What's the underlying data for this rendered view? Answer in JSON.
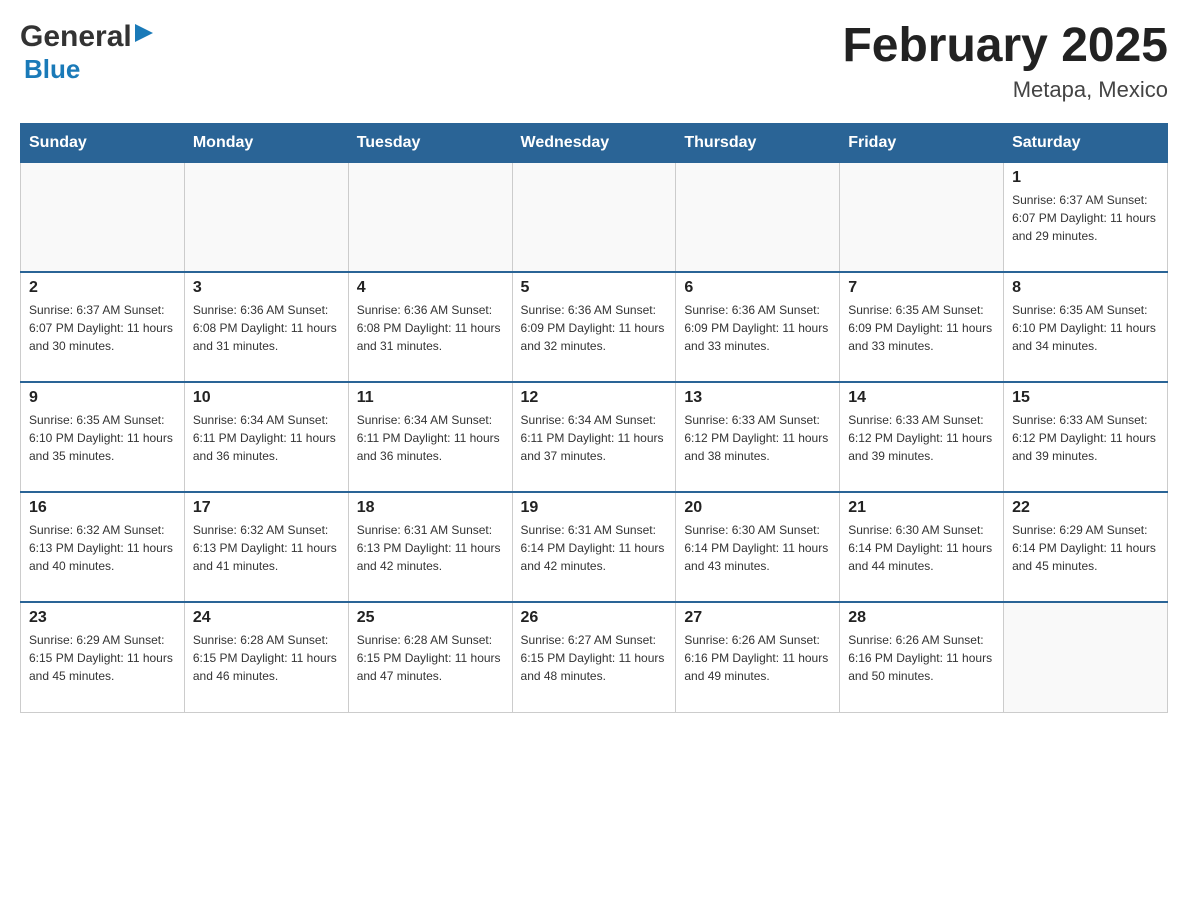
{
  "header": {
    "logo_general": "General",
    "logo_blue": "Blue",
    "month_title": "February 2025",
    "location": "Metapa, Mexico"
  },
  "weekdays": [
    "Sunday",
    "Monday",
    "Tuesday",
    "Wednesday",
    "Thursday",
    "Friday",
    "Saturday"
  ],
  "weeks": [
    {
      "days": [
        {
          "number": "",
          "info": ""
        },
        {
          "number": "",
          "info": ""
        },
        {
          "number": "",
          "info": ""
        },
        {
          "number": "",
          "info": ""
        },
        {
          "number": "",
          "info": ""
        },
        {
          "number": "",
          "info": ""
        },
        {
          "number": "1",
          "info": "Sunrise: 6:37 AM\nSunset: 6:07 PM\nDaylight: 11 hours\nand 29 minutes."
        }
      ]
    },
    {
      "days": [
        {
          "number": "2",
          "info": "Sunrise: 6:37 AM\nSunset: 6:07 PM\nDaylight: 11 hours\nand 30 minutes."
        },
        {
          "number": "3",
          "info": "Sunrise: 6:36 AM\nSunset: 6:08 PM\nDaylight: 11 hours\nand 31 minutes."
        },
        {
          "number": "4",
          "info": "Sunrise: 6:36 AM\nSunset: 6:08 PM\nDaylight: 11 hours\nand 31 minutes."
        },
        {
          "number": "5",
          "info": "Sunrise: 6:36 AM\nSunset: 6:09 PM\nDaylight: 11 hours\nand 32 minutes."
        },
        {
          "number": "6",
          "info": "Sunrise: 6:36 AM\nSunset: 6:09 PM\nDaylight: 11 hours\nand 33 minutes."
        },
        {
          "number": "7",
          "info": "Sunrise: 6:35 AM\nSunset: 6:09 PM\nDaylight: 11 hours\nand 33 minutes."
        },
        {
          "number": "8",
          "info": "Sunrise: 6:35 AM\nSunset: 6:10 PM\nDaylight: 11 hours\nand 34 minutes."
        }
      ]
    },
    {
      "days": [
        {
          "number": "9",
          "info": "Sunrise: 6:35 AM\nSunset: 6:10 PM\nDaylight: 11 hours\nand 35 minutes."
        },
        {
          "number": "10",
          "info": "Sunrise: 6:34 AM\nSunset: 6:11 PM\nDaylight: 11 hours\nand 36 minutes."
        },
        {
          "number": "11",
          "info": "Sunrise: 6:34 AM\nSunset: 6:11 PM\nDaylight: 11 hours\nand 36 minutes."
        },
        {
          "number": "12",
          "info": "Sunrise: 6:34 AM\nSunset: 6:11 PM\nDaylight: 11 hours\nand 37 minutes."
        },
        {
          "number": "13",
          "info": "Sunrise: 6:33 AM\nSunset: 6:12 PM\nDaylight: 11 hours\nand 38 minutes."
        },
        {
          "number": "14",
          "info": "Sunrise: 6:33 AM\nSunset: 6:12 PM\nDaylight: 11 hours\nand 39 minutes."
        },
        {
          "number": "15",
          "info": "Sunrise: 6:33 AM\nSunset: 6:12 PM\nDaylight: 11 hours\nand 39 minutes."
        }
      ]
    },
    {
      "days": [
        {
          "number": "16",
          "info": "Sunrise: 6:32 AM\nSunset: 6:13 PM\nDaylight: 11 hours\nand 40 minutes."
        },
        {
          "number": "17",
          "info": "Sunrise: 6:32 AM\nSunset: 6:13 PM\nDaylight: 11 hours\nand 41 minutes."
        },
        {
          "number": "18",
          "info": "Sunrise: 6:31 AM\nSunset: 6:13 PM\nDaylight: 11 hours\nand 42 minutes."
        },
        {
          "number": "19",
          "info": "Sunrise: 6:31 AM\nSunset: 6:14 PM\nDaylight: 11 hours\nand 42 minutes."
        },
        {
          "number": "20",
          "info": "Sunrise: 6:30 AM\nSunset: 6:14 PM\nDaylight: 11 hours\nand 43 minutes."
        },
        {
          "number": "21",
          "info": "Sunrise: 6:30 AM\nSunset: 6:14 PM\nDaylight: 11 hours\nand 44 minutes."
        },
        {
          "number": "22",
          "info": "Sunrise: 6:29 AM\nSunset: 6:14 PM\nDaylight: 11 hours\nand 45 minutes."
        }
      ]
    },
    {
      "days": [
        {
          "number": "23",
          "info": "Sunrise: 6:29 AM\nSunset: 6:15 PM\nDaylight: 11 hours\nand 45 minutes."
        },
        {
          "number": "24",
          "info": "Sunrise: 6:28 AM\nSunset: 6:15 PM\nDaylight: 11 hours\nand 46 minutes."
        },
        {
          "number": "25",
          "info": "Sunrise: 6:28 AM\nSunset: 6:15 PM\nDaylight: 11 hours\nand 47 minutes."
        },
        {
          "number": "26",
          "info": "Sunrise: 6:27 AM\nSunset: 6:15 PM\nDaylight: 11 hours\nand 48 minutes."
        },
        {
          "number": "27",
          "info": "Sunrise: 6:26 AM\nSunset: 6:16 PM\nDaylight: 11 hours\nand 49 minutes."
        },
        {
          "number": "28",
          "info": "Sunrise: 6:26 AM\nSunset: 6:16 PM\nDaylight: 11 hours\nand 50 minutes."
        },
        {
          "number": "",
          "info": ""
        }
      ]
    }
  ]
}
